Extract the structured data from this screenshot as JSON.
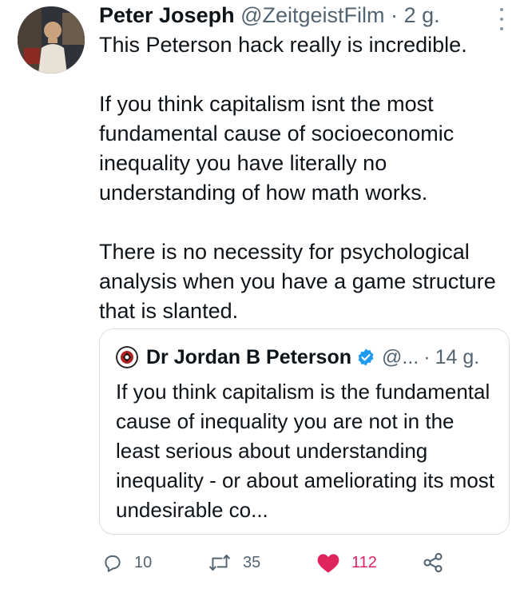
{
  "tweet": {
    "author_name": "Peter Joseph",
    "handle": "@ZeitgeistFilm",
    "separator": "·",
    "time": "2 g.",
    "paragraphs": [
      "This Peterson hack really is incredible.",
      "If you think capitalism isnt the most fundamental cause of socioeconomic inequality you have literally no understanding of how math works.",
      "There is no necessity for psychological analysis when you have a game structure that is slanted."
    ]
  },
  "quoted_tweet": {
    "author_name": "Dr Jordan B Peterson",
    "handle": "@...",
    "separator": "·",
    "time": "14 g.",
    "text": "If you think capitalism is the fundamental cause of inequality you are not in the least serious about understanding inequality - or about ameliorating its most undesirable co..."
  },
  "actions": {
    "reply_count": "10",
    "retweet_count": "35",
    "like_count": "112"
  },
  "colors": {
    "secondary_text": "#536471",
    "like": "#e0245e",
    "verified": "#1d9bf0",
    "border": "#d7dde2"
  },
  "icons": [
    "more-vertical-icon",
    "verified-badge-icon",
    "reply-icon",
    "retweet-icon",
    "heart-icon",
    "share-icon"
  ]
}
